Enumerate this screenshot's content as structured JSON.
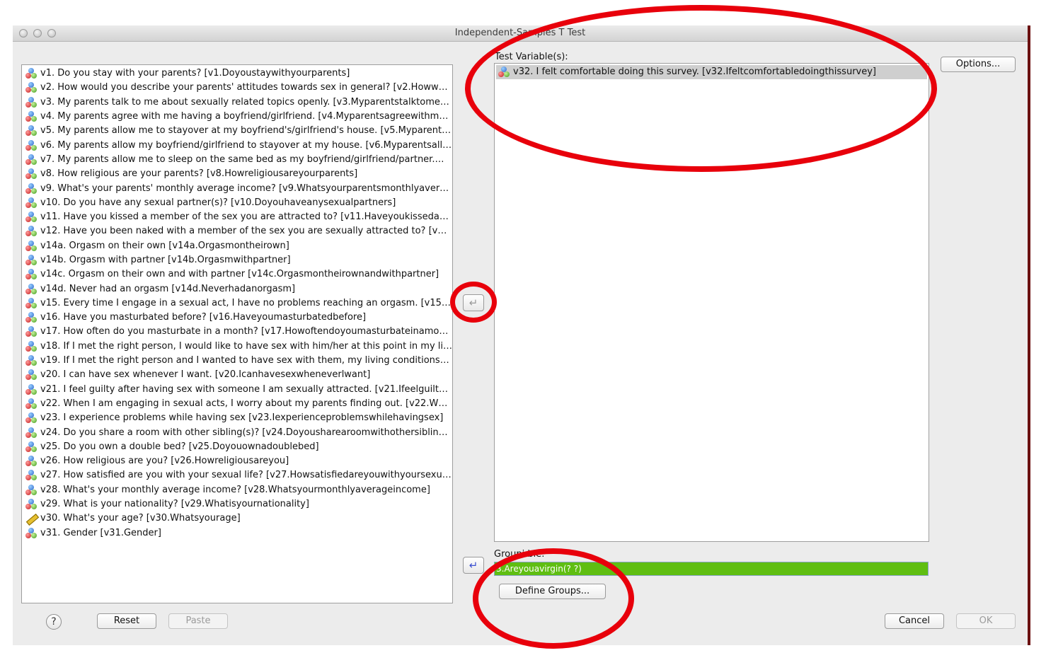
{
  "window": {
    "title": "Independent-Samples T Test"
  },
  "variables": [
    {
      "label": "v1. Do you stay with your parents? [v1.Doyoustaywithyourparents]",
      "type": "nominal"
    },
    {
      "label": "v2. How would you describe your parents' attitudes towards sex in general? [v2.Howw…",
      "type": "nominal"
    },
    {
      "label": "v3. My parents talk to me about sexually related topics openly. [v3.Myparentstalktome…",
      "type": "nominal"
    },
    {
      "label": "v4. My parents agree with me having a boyfriend/girlfriend. [v4.Myparentsagreewithm…",
      "type": "nominal"
    },
    {
      "label": "v5. My parents allow me to stayover at my boyfriend's/girlfriend's house. [v5.Myparent…",
      "type": "nominal"
    },
    {
      "label": "v6. My parents allow my boyfriend/girlfriend to stayover at my house. [v6.Myparentsall…",
      "type": "nominal"
    },
    {
      "label": "v7. My parents allow me to sleep on the same bed as my boyfriend/girlfriend/partner.…",
      "type": "nominal"
    },
    {
      "label": "v8. How religious are your parents? [v8.Howreligiousareyourparents]",
      "type": "nominal"
    },
    {
      "label": "v9. What's your parents' monthly average income? [v9.Whatsyourparentsmonthlyaverag…",
      "type": "nominal"
    },
    {
      "label": "v10. Do you have any sexual partner(s)? [v10.Doyouhaveanysexualpartners]",
      "type": "nominal"
    },
    {
      "label": "v11. Have you kissed a member of the sex you are attracted to? [v11.Haveyoukisseda…",
      "type": "nominal"
    },
    {
      "label": "v12. Have you been naked with a member of the sex you are sexually attracted to? [v1…",
      "type": "nominal"
    },
    {
      "label": "v14a. Orgasm on their own [v14a.Orgasmontheirown]",
      "type": "nominal"
    },
    {
      "label": "v14b. Orgasm with partner [v14b.Orgasmwithpartner]",
      "type": "nominal"
    },
    {
      "label": "v14c. Orgasm on their own and with partner [v14c.Orgasmontheirownandwithpartner]",
      "type": "nominal"
    },
    {
      "label": "v14d. Never had an orgasm [v14d.Neverhadanorgasm]",
      "type": "nominal"
    },
    {
      "label": "v15. Every time I engage in a sexual act, I have no problems reaching an orgasm. [v15…",
      "type": "nominal"
    },
    {
      "label": "v16. Have you masturbated before? [v16.Haveyoumasturbatedbefore]",
      "type": "nominal"
    },
    {
      "label": "v17. How often do you masturbate in a month? [v17.Howoftendoyoumasturbateinamon…",
      "type": "nominal"
    },
    {
      "label": "v18. If I met the right person, I would like to have sex with him/her at this point in my li…",
      "type": "nominal"
    },
    {
      "label": "v19. If I met the right person and I wanted to have sex with them, my living conditions…",
      "type": "nominal"
    },
    {
      "label": "v20. I can have sex whenever I want. [v20.Icanhavesexwheneverlwant]",
      "type": "nominal"
    },
    {
      "label": "v21. I feel guilty after having sex with someone I am sexually attracted. [v21.Ifeelguilty…",
      "type": "nominal"
    },
    {
      "label": "v22. When I am engaging in sexual acts, I worry about my parents finding out. [v22.Wh…",
      "type": "nominal"
    },
    {
      "label": "v23. I experience problems while having sex [v23.Iexperienceproblemswhilehavingsex]",
      "type": "nominal"
    },
    {
      "label": "v24. Do you share a room with other sibling(s)? [v24.Doyousharearoomwithothersiblings]",
      "type": "nominal"
    },
    {
      "label": "v25. Do you own a double bed? [v25.Doyouownadoublebed]",
      "type": "nominal"
    },
    {
      "label": "v26. How religious are you? [v26.Howreligiousareyou]",
      "type": "nominal"
    },
    {
      "label": "v27. How satisfied are you with your sexual life? [v27.Howsatisfiedareyouwithyoursexu…",
      "type": "nominal"
    },
    {
      "label": "v28. What's your monthly average income? [v28.Whatsyourmonthlyaverageincome]",
      "type": "nominal"
    },
    {
      "label": "v29. What is your nationality? [v29.Whatisyournationality]",
      "type": "nominal"
    },
    {
      "label": "v30. What's your age? [v30.Whatsyourage]",
      "type": "scale"
    },
    {
      "label": "v31. Gender [v31.Gender]",
      "type": "nominal"
    }
  ],
  "test_vars": {
    "label": "Test Variable(s):",
    "items": [
      "v32. I felt comfortable doing this survey. [v32.Ifeltcomfortabledoingthissurvey]"
    ]
  },
  "grouping": {
    "label": "Groupi          ble:",
    "value": "   3.Areyouavirgin(? ?)"
  },
  "buttons": {
    "options": "Options...",
    "define_groups": "Define Groups...",
    "reset": "Reset",
    "paste": "Paste",
    "cancel": "Cancel",
    "ok": "OK",
    "help": "?"
  },
  "icons": {
    "move_test": "arrow-left-icon",
    "move_group": "arrow-left-icon",
    "nominal": "nominal-variable-icon",
    "scale": "scale-ruler-icon"
  },
  "colors": {
    "annotation": "#e8000b",
    "grouping_bg": "#5fbe12"
  }
}
